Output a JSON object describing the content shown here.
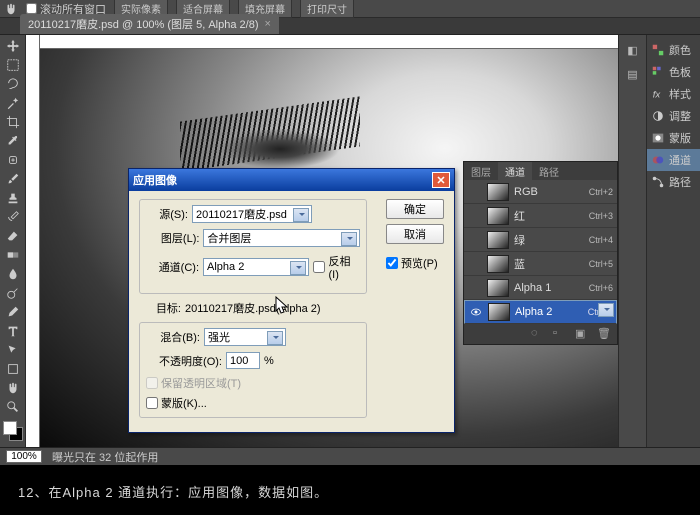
{
  "topbar": {
    "scroll_all": "滚动所有窗口",
    "btns": [
      "实际像素",
      "适合屏幕",
      "填充屏幕",
      "打印尺寸"
    ]
  },
  "doc": {
    "tab": "20110217磨皮.psd @ 100% (图层 5, Alpha 2/8)"
  },
  "status": {
    "zoom": "100%",
    "info": "曝光只在 32 位起作用"
  },
  "dlg": {
    "title": "应用图像",
    "ok": "确定",
    "cancel": "取消",
    "preview": "预览(P)",
    "src_lbl": "源(S):",
    "src_val": "20110217磨皮.psd",
    "layer_lbl": "图层(L):",
    "layer_val": "合并图层",
    "ch_lbl": "通道(C):",
    "ch_val": "Alpha 2",
    "invert": "反相(I)",
    "target_lbl": "目标:",
    "target_val": "20110217磨皮.psd(Alpha 2)",
    "blend_lbl": "混合(B):",
    "blend_val": "强光",
    "opac_lbl": "不透明度(O):",
    "opac_val": "100",
    "pct": "%",
    "preserve": "保留透明区域(T)",
    "mask": "蒙版(K)..."
  },
  "channels": {
    "tabs": [
      "图层",
      "通道",
      "路径"
    ],
    "rows": [
      {
        "name": "RGB",
        "key": "Ctrl+2"
      },
      {
        "name": "红",
        "key": "Ctrl+3"
      },
      {
        "name": "绿",
        "key": "Ctrl+4"
      },
      {
        "name": "蓝",
        "key": "Ctrl+5"
      },
      {
        "name": "Alpha 1",
        "key": "Ctrl+6"
      },
      {
        "name": "Alpha 2",
        "key": "Ctrl+7"
      }
    ]
  },
  "side": {
    "items": [
      "颜色",
      "色板",
      "样式",
      "调整",
      "蒙版",
      "通道",
      "路径"
    ]
  },
  "caption": "12、在Alpha 2 通道执行：应用图像，数据如图。"
}
